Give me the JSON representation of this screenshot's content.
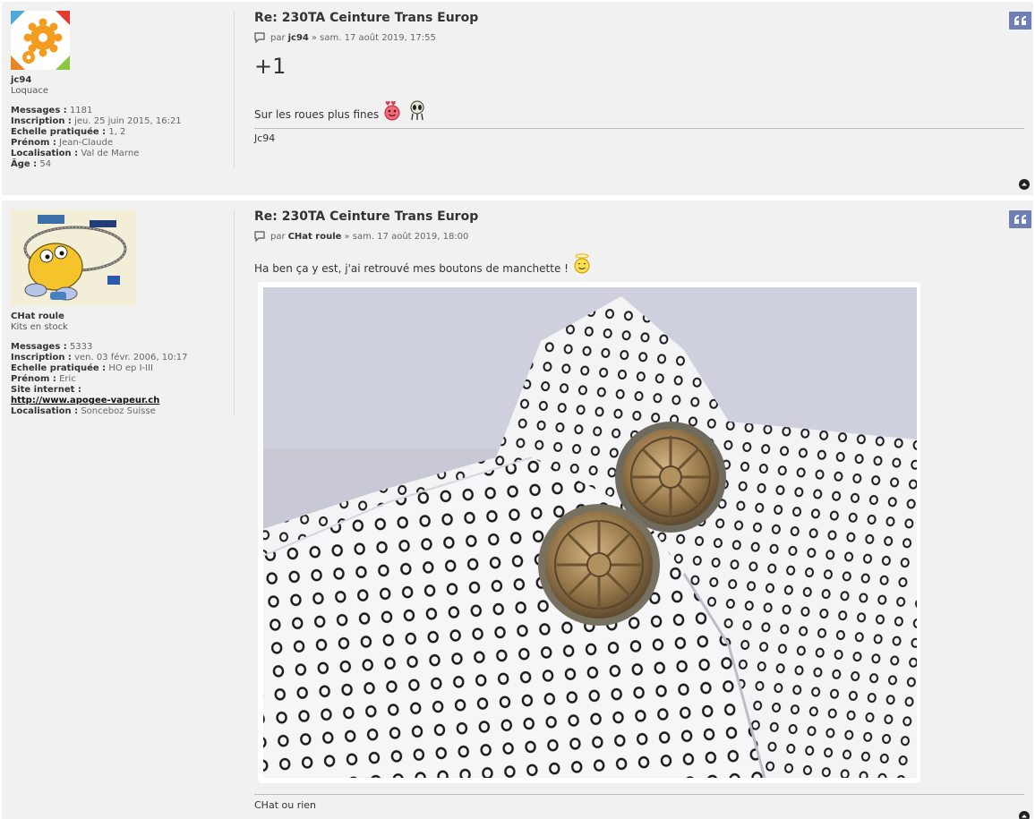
{
  "posts": [
    {
      "user": {
        "name": "jc94",
        "rank": "Loquace",
        "stats": [
          {
            "label": "Messages :",
            "value": " 1181"
          },
          {
            "label": "Inscription :",
            "value": " jeu. 25 juin 2015, 16:21"
          },
          {
            "label": "Echelle pratiquée :",
            "value": " 1, 2"
          },
          {
            "label": "Prénom :",
            "value": " Jean-Claude"
          },
          {
            "label": "Localisation :",
            "value": " Val de Marne"
          },
          {
            "label": "Âge :",
            "value": " 54"
          }
        ]
      },
      "title": "Re: 230TA Ceinture Trans Europ",
      "meta_by": "par",
      "author": "jc94",
      "date": "» sam. 17 août 2019, 17:55",
      "big_text": "+1",
      "text": "Sur les roues plus fines",
      "signature": "Jc94"
    },
    {
      "user": {
        "name": "CHat roule",
        "rank": "Kits en stock",
        "stats": [
          {
            "label": "Messages :",
            "value": " 5333"
          },
          {
            "label": "Inscription :",
            "value": " ven. 03 févr. 2006, 10:17"
          },
          {
            "label": "Echelle pratiquée :",
            "value": " HO ep I-III"
          },
          {
            "label": "Prénom :",
            "value": " Eric"
          }
        ],
        "site_label": "Site internet :",
        "site_url": "http://www.apogee-vapeur.ch",
        "loc_label": "Localisation :",
        "loc_value": " Sonceboz Suisse"
      },
      "title": "Re: 230TA Ceinture Trans Europ",
      "meta_by": "par",
      "author": "CHat roule",
      "date": "» sam. 17 août 2019, 18:00",
      "text": "Ha ben ça y est, j'ai retrouvé mes boutons de manchette !",
      "signature": "CHat ou rien"
    }
  ],
  "icons": {
    "quote": "quote-icon",
    "post": "post-icon",
    "up": "arrow-up-circle-icon"
  },
  "colors": {
    "quote_button": "#6d7fb5",
    "post_bg": "#f1f1f1"
  }
}
